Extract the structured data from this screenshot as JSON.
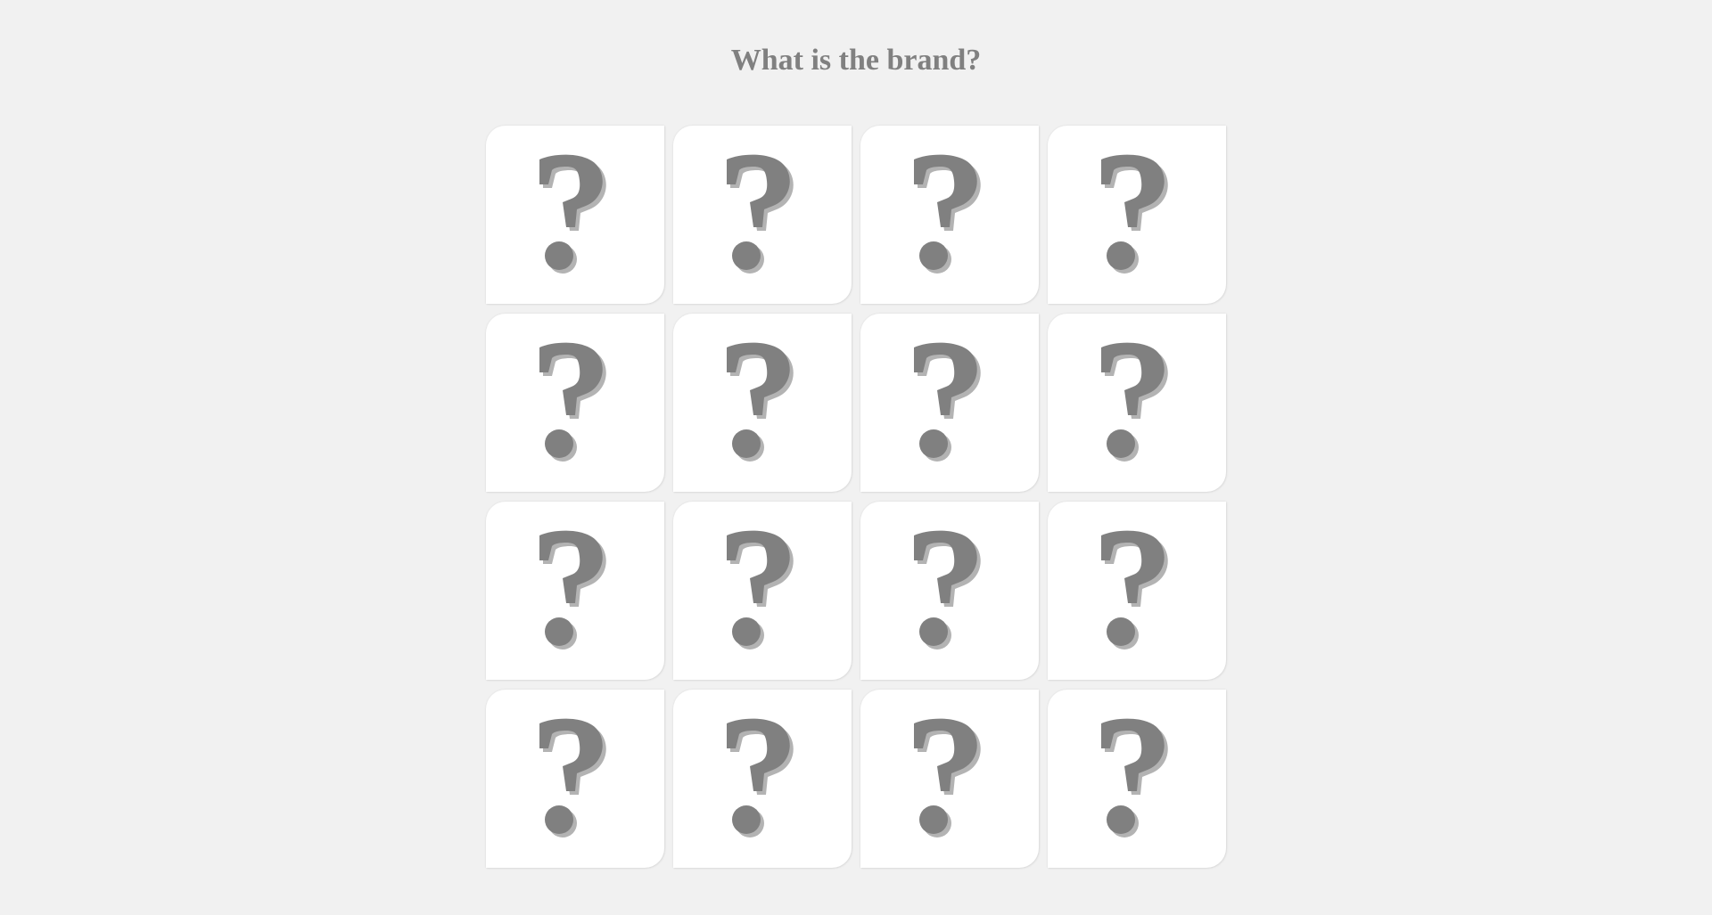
{
  "game": {
    "title": "What is the brand?"
  },
  "board": {
    "rows": 4,
    "columns": 4,
    "cards": [
      {
        "face": "question-mark-icon"
      },
      {
        "face": "question-mark-icon"
      },
      {
        "face": "question-mark-icon"
      },
      {
        "face": "question-mark-icon"
      },
      {
        "face": "question-mark-icon"
      },
      {
        "face": "question-mark-icon"
      },
      {
        "face": "question-mark-icon"
      },
      {
        "face": "question-mark-icon"
      },
      {
        "face": "question-mark-icon"
      },
      {
        "face": "question-mark-icon"
      },
      {
        "face": "question-mark-icon"
      },
      {
        "face": "question-mark-icon"
      },
      {
        "face": "question-mark-icon"
      },
      {
        "face": "question-mark-icon"
      },
      {
        "face": "question-mark-icon"
      },
      {
        "face": "question-mark-icon"
      }
    ]
  },
  "colors": {
    "background": "#f1f1f1",
    "card": "#ffffff",
    "title": "#808080",
    "glyph": "#808080",
    "glyph_shadow": "#b3b3b3"
  }
}
